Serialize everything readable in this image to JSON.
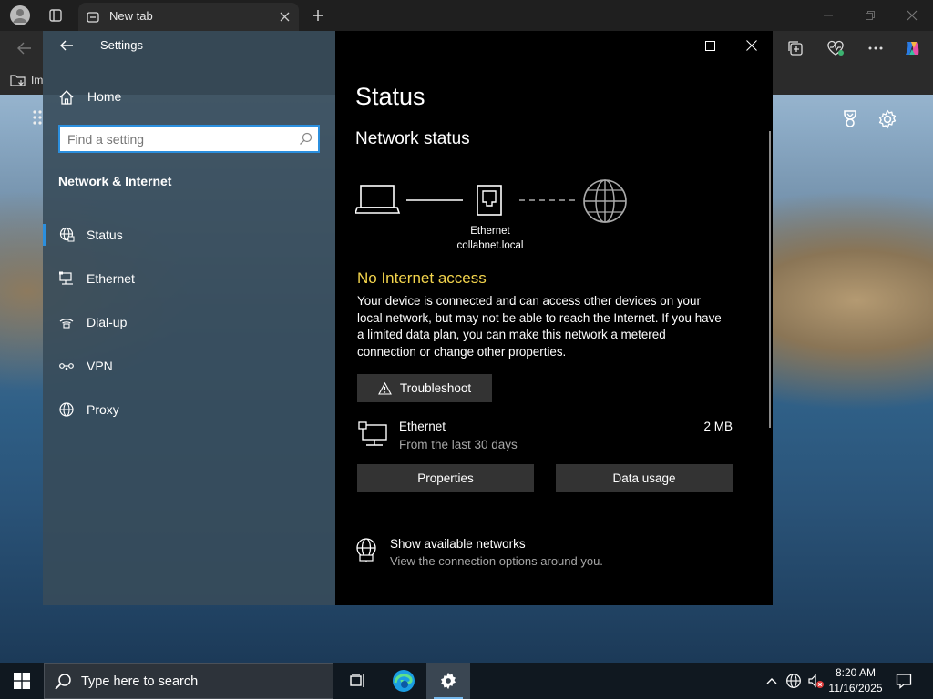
{
  "browser": {
    "tab_title": "New tab",
    "favorites_label": "Im"
  },
  "settings": {
    "window_title": "Settings",
    "home_label": "Home",
    "search_placeholder": "Find a setting",
    "section_title": "Network & Internet",
    "nav_items": [
      {
        "label": "Status",
        "icon": "globe-icon"
      },
      {
        "label": "Ethernet",
        "icon": "ethernet-icon"
      },
      {
        "label": "Dial-up",
        "icon": "dialup-icon"
      },
      {
        "label": "VPN",
        "icon": "vpn-icon"
      },
      {
        "label": "Proxy",
        "icon": "globe-icon"
      }
    ],
    "page_title": "Status",
    "network_status_title": "Network status",
    "diagram": {
      "adapter_name": "Ethernet",
      "network_name": "collabnet.local"
    },
    "warning_heading": "No Internet access",
    "warning_text": "Your device is connected and can access other devices on your local network, but may not be able to reach the Internet. If you have a limited data plan, you can make this network a metered connection or change other properties.",
    "troubleshoot_label": "Troubleshoot",
    "connection": {
      "name": "Ethernet",
      "period": "From the last 30 days",
      "usage": "2 MB"
    },
    "properties_label": "Properties",
    "data_usage_label": "Data usage",
    "show_networks": {
      "title": "Show available networks",
      "subtitle": "View the connection options around you."
    }
  },
  "taskbar": {
    "search_placeholder": "Type here to search",
    "time": "8:20 AM",
    "date": "11/16/2025"
  },
  "colors": {
    "accent": "#2b8fde",
    "warning": "#f3d44c"
  }
}
